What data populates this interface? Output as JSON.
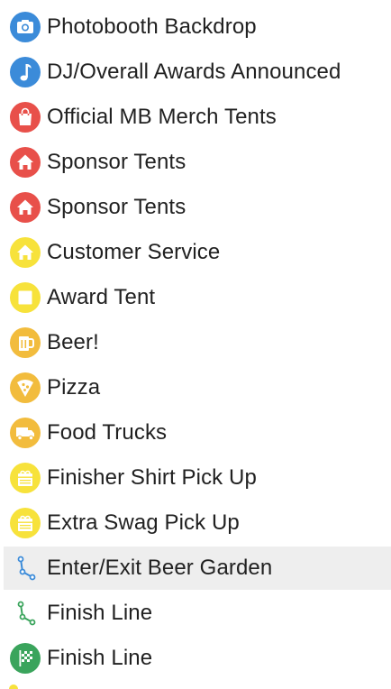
{
  "legend": {
    "items": [
      {
        "label": "Photobooth Backdrop",
        "icon": "camera-icon",
        "color": "#3b8bd9"
      },
      {
        "label": "DJ/Overall Awards Announced",
        "icon": "music-note-icon",
        "color": "#3b8bd9"
      },
      {
        "label": "Official MB Merch Tents",
        "icon": "shopping-bag-icon",
        "color": "#e8504a"
      },
      {
        "label": "Sponsor Tents",
        "icon": "home-icon",
        "color": "#e8504a"
      },
      {
        "label": "Sponsor Tents",
        "icon": "home-icon",
        "color": "#e8504a"
      },
      {
        "label": "Customer Service",
        "icon": "home-icon",
        "color": "#f7e23b"
      },
      {
        "label": "Award Tent",
        "icon": "square-icon",
        "color": "#f7e23b"
      },
      {
        "label": "Beer!",
        "icon": "beer-mug-icon",
        "color": "#f2bc3d"
      },
      {
        "label": "Pizza",
        "icon": "pizza-slice-icon",
        "color": "#f2bc3d"
      },
      {
        "label": "Food Trucks",
        "icon": "truck-icon",
        "color": "#f2bc3d"
      },
      {
        "label": "Finisher Shirt Pick Up",
        "icon": "gift-box-icon",
        "color": "#f7e23b"
      },
      {
        "label": "Extra Swag Pick Up",
        "icon": "gift-box-icon",
        "color": "#f7e23b"
      },
      {
        "label": "Enter/Exit Beer Garden",
        "icon": "route-icon",
        "color": "#3b8bd9",
        "hovered": true
      },
      {
        "label": "Finish Line",
        "icon": "route-icon",
        "color": "#3aa45c"
      },
      {
        "label": "Finish Line",
        "icon": "checkered-flag-icon",
        "color": "#3aa45c"
      }
    ],
    "next_item_color": "#f7e23b"
  }
}
